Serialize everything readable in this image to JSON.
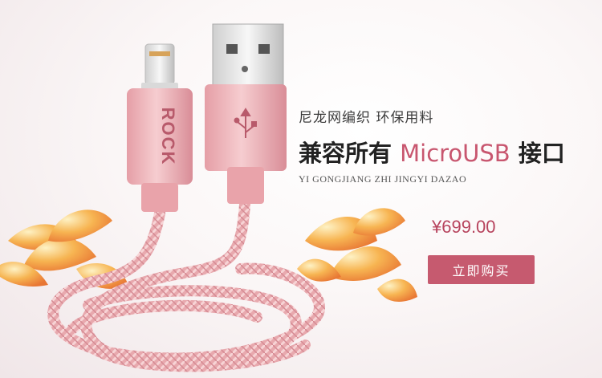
{
  "product": {
    "subtitle": "尼龙网编织 环保用料",
    "headline_prefix": "兼容所有",
    "headline_accent": "MicroUSB",
    "headline_suffix": "接口",
    "tagline": "YI GONGJIANG ZHI JINGYI DAZAO",
    "price": "¥699.00",
    "buy_label": "立即购买",
    "brand_mark": "ROCK"
  },
  "colors": {
    "accent": "#c8566f",
    "button": "#c65a6f",
    "cable": "#e7b0b4",
    "flower": "#f2a03a"
  },
  "icons": {
    "usb_symbol": "usb-icon",
    "flower_left": "flower-illustration",
    "flower_right": "flower-illustration"
  }
}
